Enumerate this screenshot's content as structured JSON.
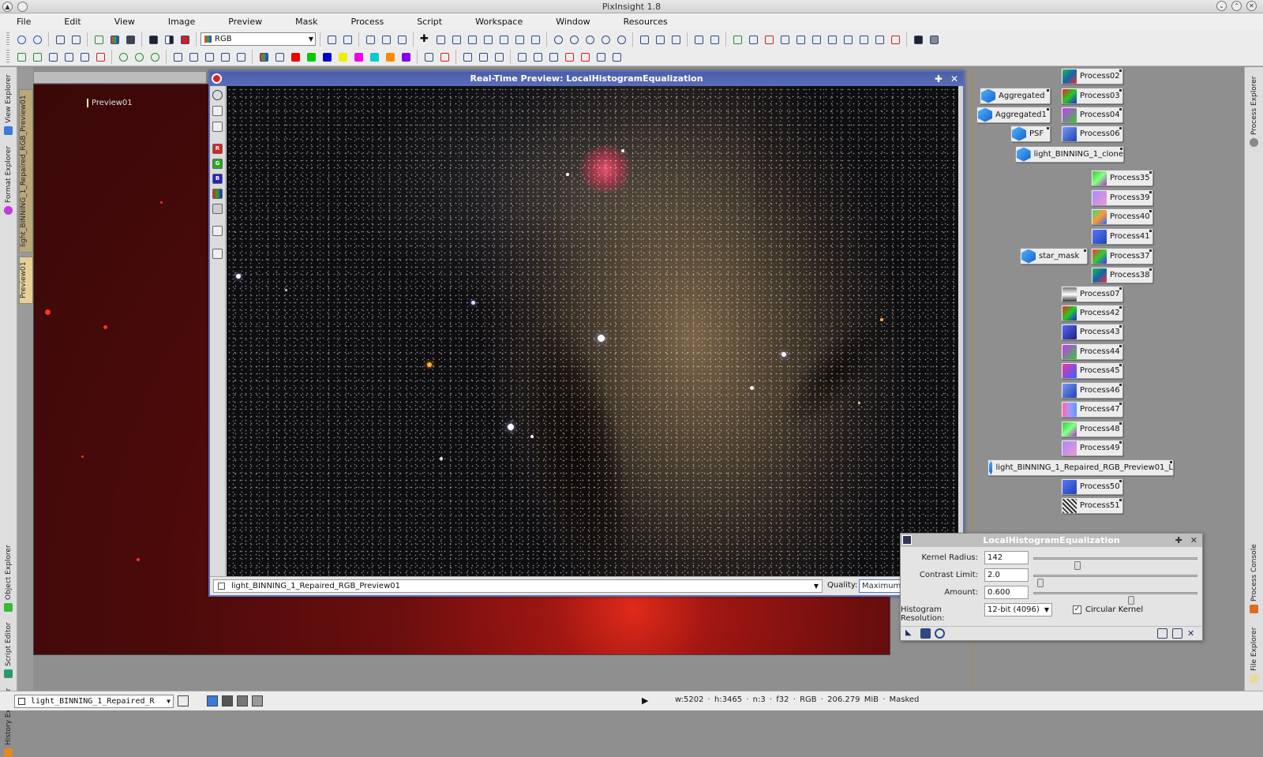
{
  "app": {
    "title": "PixInsight 1.8"
  },
  "menu": [
    "File",
    "Edit",
    "View",
    "Image",
    "Preview",
    "Mask",
    "Process",
    "Script",
    "Workspace",
    "Window",
    "Resources"
  ],
  "toolbar": {
    "channel_select": "RGB"
  },
  "colors": {
    "accent": "#5b6fb8",
    "image_bg": "#5a0c0c",
    "preview_mark": "#ffffff"
  },
  "left_sidebar": {
    "tabs": [
      {
        "label": "View Explorer",
        "icon": "view-explorer-icon"
      },
      {
        "label": "Format Explorer",
        "icon": "format-explorer-icon"
      },
      {
        "label": "Object Explorer",
        "icon": "object-explorer-icon"
      },
      {
        "label": "Script Editor",
        "icon": "script-editor-icon"
      },
      {
        "label": "History Explorer",
        "icon": "history-explorer-icon"
      }
    ]
  },
  "image_window": {
    "main_tab": "light_BINNING_1_Repaired_RGB_Preview01",
    "preview_tab": "Preview01",
    "preview_label": "Preview01"
  },
  "realtime_preview": {
    "title": "Real-Time Preview: LocalHistogramEqualization",
    "view_selector": "light_BINNING_1_Repaired_RGB_Preview01",
    "quality_label": "Quality:",
    "quality_value": "Maximum",
    "tool_labels": [
      "R",
      "G",
      "B"
    ]
  },
  "process_icons": [
    {
      "label": "Process02",
      "kind": "process"
    },
    {
      "label": "Aggregated",
      "kind": "instance"
    },
    {
      "label": "Process03",
      "kind": "process"
    },
    {
      "label": "Aggregated1",
      "kind": "instance"
    },
    {
      "label": "Process04",
      "kind": "process"
    },
    {
      "label": "PSF",
      "kind": "instance"
    },
    {
      "label": "Process06",
      "kind": "process"
    },
    {
      "label": "light_BINNING_1_clone",
      "kind": "instance"
    },
    {
      "label": "Process35",
      "kind": "process"
    },
    {
      "label": "Process39",
      "kind": "process"
    },
    {
      "label": "Process40",
      "kind": "process"
    },
    {
      "label": "Process41",
      "kind": "process"
    },
    {
      "label": "star_mask",
      "kind": "instance"
    },
    {
      "label": "Process37",
      "kind": "process"
    },
    {
      "label": "Process38",
      "kind": "process"
    },
    {
      "label": "Process07",
      "kind": "process"
    },
    {
      "label": "Process42",
      "kind": "process"
    },
    {
      "label": "Process43",
      "kind": "process"
    },
    {
      "label": "Process44",
      "kind": "process"
    },
    {
      "label": "Process45",
      "kind": "process"
    },
    {
      "label": "Process46",
      "kind": "process"
    },
    {
      "label": "Process47",
      "kind": "process"
    },
    {
      "label": "Process48",
      "kind": "process"
    },
    {
      "label": "Process49",
      "kind": "process"
    },
    {
      "label": "light_BINNING_1_Repaired_RGB_Preview01_L",
      "kind": "instance"
    },
    {
      "label": "Process50",
      "kind": "process"
    },
    {
      "label": "Process51",
      "kind": "process"
    }
  ],
  "lhe": {
    "title": "LocalHistogramEqualization",
    "kernel_radius_label": "Kernel Radius:",
    "kernel_radius": "142",
    "kernel_radius_level": 0.26,
    "contrast_limit_label": "Contrast Limit:",
    "contrast_limit": "2.0",
    "contrast_limit_level": 0.02,
    "amount_label": "Amount:",
    "amount": "0.600",
    "amount_level": 0.6,
    "histogram_resolution_label": "Histogram Resolution:",
    "histogram_resolution": "12-bit (4096)",
    "circular_kernel_label": "Circular Kernel",
    "circular_kernel_checked": true
  },
  "right_sidebar": {
    "tabs": [
      {
        "label": "Process Explorer",
        "icon": "process-explorer-icon"
      },
      {
        "label": "Process Console",
        "icon": "process-console-icon"
      },
      {
        "label": "File Explorer",
        "icon": "file-explorer-icon"
      }
    ]
  },
  "statusbar": {
    "view": "light_BINNING_1_Repaired_R",
    "info": "w:5202 · h:3465 · n:3 · f32 · RGB · 206.279 MiB · Masked"
  }
}
